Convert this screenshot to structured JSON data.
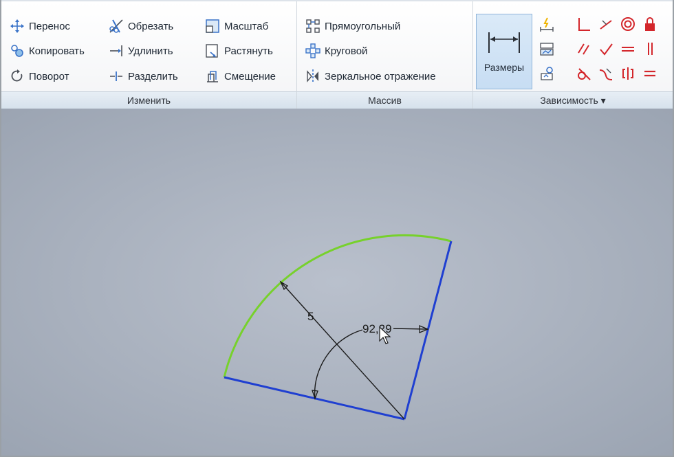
{
  "ribbon": {
    "modify": {
      "title": "Изменить",
      "col1": [
        "Перенос",
        "Копировать",
        "Поворот"
      ],
      "col2": [
        "Обрезать",
        "Удлинить",
        "Разделить"
      ],
      "col3": [
        "Масштаб",
        "Растянуть",
        "Смещение"
      ]
    },
    "pattern": {
      "title": "Массив",
      "items": [
        "Прямоугольный",
        "Круговой",
        "Зеркальное отражение"
      ]
    },
    "constrain": {
      "title": "Зависимость ▾",
      "dimension_label": "Размеры"
    }
  },
  "icons": {
    "move": "move-icon",
    "copy": "copy-icon",
    "rotate": "rotate-icon",
    "trim": "trim-icon",
    "extend": "extend-icon",
    "split": "split-icon",
    "scale": "scale-icon",
    "stretch": "stretch-icon",
    "offset": "offset-icon",
    "rect_pattern": "rectangular-pattern-icon",
    "circ_pattern": "circular-pattern-icon",
    "mirror": "mirror-icon"
  },
  "sketch": {
    "radius_dim": "5",
    "angle_dim": "92,29"
  },
  "colors": {
    "arc": "#77d12c",
    "lines": "#1f3fd1",
    "accent_blue": "#2f6fd1",
    "constraint_red": "#d3262b"
  }
}
